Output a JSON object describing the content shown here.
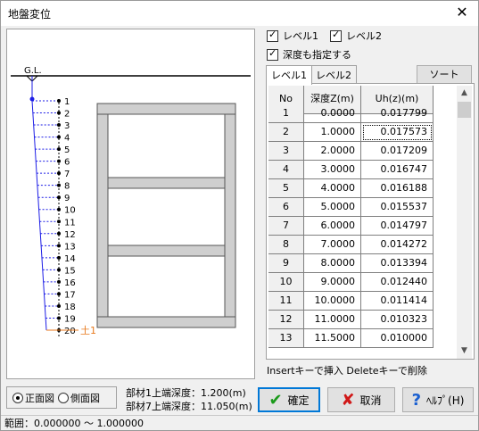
{
  "window": {
    "title": "地盤変位",
    "close_glyph": "✕"
  },
  "options": {
    "level1_label": "レベル1",
    "level1_checked": true,
    "level2_label": "レベル2",
    "level2_checked": true,
    "depth_label": "深度も指定する",
    "depth_checked": true
  },
  "tabs": [
    {
      "label": "レベル1",
      "active": true
    },
    {
      "label": "レベル2",
      "active": false
    }
  ],
  "sort_label": "ソート",
  "table": {
    "columns": [
      "No",
      "深度Z(m)",
      "Uh(z)(m)"
    ],
    "rows": [
      [
        "1",
        "0.0000",
        "0.017799"
      ],
      [
        "2",
        "1.0000",
        "0.017573"
      ],
      [
        "3",
        "2.0000",
        "0.017209"
      ],
      [
        "4",
        "3.0000",
        "0.016747"
      ],
      [
        "5",
        "4.0000",
        "0.016188"
      ],
      [
        "6",
        "5.0000",
        "0.015537"
      ],
      [
        "7",
        "6.0000",
        "0.014797"
      ],
      [
        "8",
        "7.0000",
        "0.014272"
      ],
      [
        "9",
        "8.0000",
        "0.013394"
      ],
      [
        "10",
        "9.0000",
        "0.012440"
      ],
      [
        "11",
        "10.0000",
        "0.011414"
      ],
      [
        "12",
        "11.0000",
        "0.010323"
      ],
      [
        "13",
        "11.5000",
        "0.010000"
      ]
    ]
  },
  "hint": "Insertキーで挿入 Deleteキーで削除",
  "view": {
    "front_label": "正面図",
    "side_label": "側面図",
    "selected": "front"
  },
  "member_info": {
    "line1": "部材1上端深度：1.200(m)",
    "line2": "部材7上端深度：11.050(m)"
  },
  "buttons": {
    "ok": "確定",
    "cancel": "取消",
    "help": "ﾍﾙﾌﾟ(H)"
  },
  "status": "範囲：0.000000 ～ 1.000000",
  "diagram": {
    "gl_label": "G.L.",
    "soil_label": "土1",
    "node_labels": [
      "1",
      "2",
      "3",
      "4",
      "5",
      "6",
      "7",
      "8",
      "9",
      "10",
      "11",
      "12",
      "13",
      "14",
      "15",
      "16",
      "17",
      "18",
      "19",
      "20"
    ],
    "colors": {
      "profile": "#1e1ee6",
      "soil": "#e87a1e",
      "frame": "#cfcfcf"
    }
  }
}
